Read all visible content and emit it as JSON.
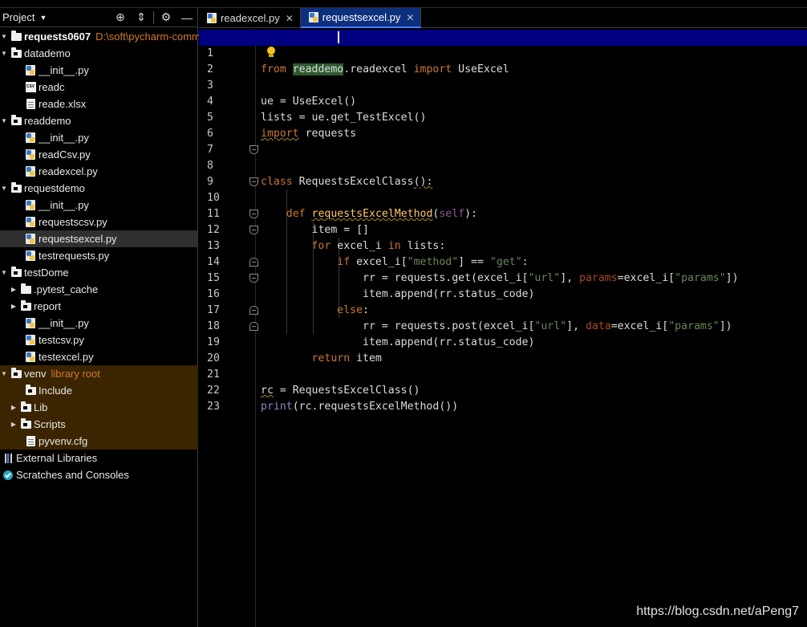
{
  "project_panel": {
    "title": "Project",
    "tree": [
      {
        "label": "requests0607",
        "hint": "D:\\soft\\pycharm-commun",
        "icon": "folder-icon",
        "expanded": true
      },
      {
        "label": "datademo",
        "icon": "folder-icon",
        "expanded": true
      },
      {
        "label": "__init__.py",
        "icon": "python-file-icon"
      },
      {
        "label": "readc",
        "icon": "csv-file-icon"
      },
      {
        "label": "reade.xlsx",
        "icon": "text-file-icon"
      },
      {
        "label": "readdemo",
        "icon": "folder-icon",
        "expanded": true
      },
      {
        "label": "__init__.py",
        "icon": "python-file-icon"
      },
      {
        "label": "readCsv.py",
        "icon": "python-file-icon"
      },
      {
        "label": "readexcel.py",
        "icon": "python-file-icon"
      },
      {
        "label": "requestdemo",
        "icon": "folder-icon",
        "expanded": true
      },
      {
        "label": "__init__.py",
        "icon": "python-file-icon"
      },
      {
        "label": "requestscsv.py",
        "icon": "python-file-icon"
      },
      {
        "label": "requestsexcel.py",
        "icon": "python-file-icon",
        "selected": true
      },
      {
        "label": "testrequests.py",
        "icon": "python-file-icon"
      },
      {
        "label": "testDome",
        "icon": "folder-icon",
        "expanded": true
      },
      {
        "label": ".pytest_cache",
        "icon": "folder-icon",
        "expanded": false
      },
      {
        "label": "report",
        "icon": "folder-icon",
        "expanded": false
      },
      {
        "label": "__init__.py",
        "icon": "python-file-icon"
      },
      {
        "label": "testcsv.py",
        "icon": "python-file-icon"
      },
      {
        "label": "testexcel.py",
        "icon": "python-file-icon"
      },
      {
        "label": "venv",
        "hint": "library root",
        "icon": "folder-icon",
        "expanded": true
      },
      {
        "label": "Include",
        "icon": "folder-icon"
      },
      {
        "label": "Lib",
        "icon": "folder-icon",
        "expanded": false
      },
      {
        "label": "Scripts",
        "icon": "folder-icon",
        "expanded": false
      },
      {
        "label": "pyvenv.cfg",
        "icon": "text-file-icon"
      },
      {
        "label": "External Libraries",
        "icon": "library-icon"
      },
      {
        "label": "Scratches and Consoles",
        "icon": "scratch-icon"
      }
    ]
  },
  "tabs": [
    {
      "label": "readexcel.py",
      "active": false
    },
    {
      "label": "requestsexcel.py",
      "active": true
    }
  ],
  "editor": {
    "current_line": 1,
    "line_numbers": [
      "1",
      "2",
      "3",
      "4",
      "5",
      "6",
      "7",
      "8",
      "9",
      "10",
      "11",
      "12",
      "13",
      "14",
      "15",
      "16",
      "17",
      "18",
      "19",
      "20",
      "21",
      "22",
      "23"
    ],
    "code": {
      "l1_from": "from",
      "l1_mod": "readdemo",
      "l1_rest": ".readexcel ",
      "l1_import": "import",
      "l1_name": " UseExcel",
      "l3": "ue = UseExcel()",
      "l4": "lists = ue.get_TestExcel()",
      "l5_import": "import",
      "l5_rest": " requests",
      "l8_class": "class",
      "l8_name": " RequestsExcelClass",
      "l8_rest": "():",
      "l10_def": "def",
      "l10_name": "requestsExcelMethod",
      "l10_open": "(",
      "l10_self": "self",
      "l10_close": "):",
      "l11": "item = []",
      "l12_for": "for",
      "l12_var": " excel_i ",
      "l12_in": "in",
      "l12_rest": " lists:",
      "l13_if": "if",
      "l13_a": " excel_i[",
      "l13_s1": "\"method\"",
      "l13_b": "] == ",
      "l13_s2": "\"get\"",
      "l13_c": ":",
      "l14_a": "rr = requests.get(excel_i[",
      "l14_s1": "\"url\"",
      "l14_b": "], ",
      "l14_p": "params",
      "l14_c": "=excel_i[",
      "l14_s2": "\"params\"",
      "l14_d": "])",
      "l15": "item.append(rr.status_code)",
      "l16_else": "else",
      "l16_rest": ":",
      "l17_a": "rr = requests.post(excel_i[",
      "l17_s1": "\"url\"",
      "l17_b": "], ",
      "l17_p": "data",
      "l17_c": "=excel_i[",
      "l17_s2": "\"params\"",
      "l17_d": "])",
      "l18": "item.append(rr.status_code)",
      "l19_return": "return",
      "l19_rest": " item",
      "l21_a": "rc",
      "l21_b": " = RequestsExcelClass()",
      "l22_print": "print",
      "l22_rest": "(rc.requestsExcelMethod())"
    }
  },
  "watermark": "https://blog.csdn.net/aPeng7",
  "colors": {
    "keyword": "#cc7832",
    "string": "#6a8759",
    "function": "#ffc66d",
    "self": "#94558d",
    "param": "#aa4926",
    "current_line": "#000080",
    "active_tab": "#0c2f7e",
    "library_root": "#d17b2a"
  }
}
